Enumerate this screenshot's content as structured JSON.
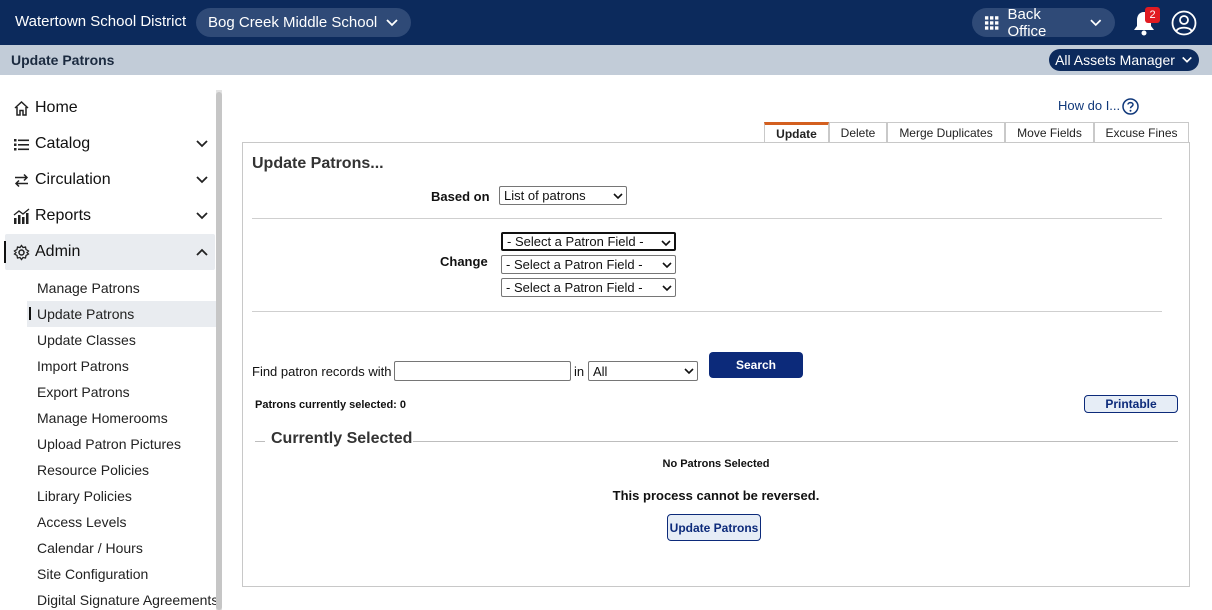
{
  "header": {
    "district": "Watertown School District",
    "school": "Bog Creek Middle School",
    "office": "Back Office",
    "notification_count": "2"
  },
  "subbar": {
    "title": "Update Patrons",
    "role": "All Assets Manager"
  },
  "sidebar": {
    "items": [
      {
        "label": "Home",
        "icon": "home-icon"
      },
      {
        "label": "Catalog",
        "icon": "list-icon"
      },
      {
        "label": "Circulation",
        "icon": "swap-icon"
      },
      {
        "label": "Reports",
        "icon": "chart-icon"
      },
      {
        "label": "Admin",
        "icon": "gear-icon"
      }
    ],
    "admin_items": [
      "Manage Patrons",
      "Update Patrons",
      "Update Classes",
      "Import Patrons",
      "Export Patrons",
      "Manage Homerooms",
      "Upload Patron Pictures",
      "Resource Policies",
      "Library Policies",
      "Access Levels",
      "Calendar / Hours",
      "Site Configuration",
      "Digital Signature Agreements"
    ]
  },
  "help": {
    "label": "How do I..."
  },
  "tabs": [
    "Update",
    "Delete",
    "Merge Duplicates",
    "Move Fields",
    "Excuse Fines"
  ],
  "form": {
    "title": "Update Patrons...",
    "based_on_label": "Based on",
    "based_on_value": "List of patrons",
    "change_label": "Change",
    "field_select_1": "- Select a Patron Field -",
    "field_select_2": "- Select a Patron Field -",
    "field_select_3": "- Select a Patron Field -",
    "find_label": "Find patron records with",
    "find_value": "",
    "in_label": "in",
    "in_value": "All",
    "search_label": "Search",
    "selected_count": "Patrons currently selected: 0",
    "printable_label": "Printable",
    "currently_selected_title": "Currently Selected",
    "no_patrons": "No Patrons Selected",
    "warning": "This process cannot be reversed.",
    "update_label": "Update Patrons"
  }
}
